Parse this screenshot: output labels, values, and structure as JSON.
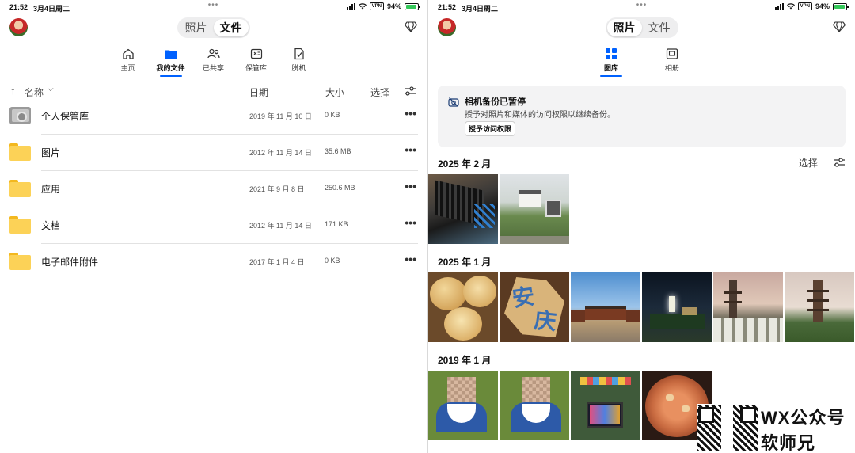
{
  "status": {
    "time": "21:52",
    "date": "3月4日周二",
    "battery": "94%",
    "vpn": "VPN",
    "dots": "•••"
  },
  "left": {
    "segment": {
      "photos": "照片",
      "files": "文件"
    },
    "nav": [
      {
        "label": "主页",
        "icon": "home-icon"
      },
      {
        "label": "我的文件",
        "icon": "folder-icon",
        "active": true
      },
      {
        "label": "已共享",
        "icon": "people-icon"
      },
      {
        "label": "保管库",
        "icon": "vault-icon"
      },
      {
        "label": "脱机",
        "icon": "offline-icon"
      }
    ],
    "table": {
      "name_col": "名称",
      "date_col": "日期",
      "size_col": "大小",
      "select": "选择",
      "rows": [
        {
          "name": "个人保管库",
          "date": "2019 年 11 月 10 日",
          "size": "0 KB",
          "icon": "vault-icon"
        },
        {
          "name": "图片",
          "date": "2012 年 11 月 14 日",
          "size": "35.6 MB",
          "icon": "folder-icon"
        },
        {
          "name": "应用",
          "date": "2021 年 9 月 8 日",
          "size": "250.6 MB",
          "icon": "folder-icon"
        },
        {
          "name": "文档",
          "date": "2012 年 11 月 14 日",
          "size": "171 KB",
          "icon": "folder-icon"
        },
        {
          "name": "电子邮件附件",
          "date": "2017 年 1 月 4 日",
          "size": "0 KB",
          "icon": "folder-icon"
        }
      ],
      "more": "•••"
    }
  },
  "right": {
    "segment": {
      "photos": "照片",
      "files": "文件"
    },
    "nav": [
      {
        "label": "图库",
        "icon": "gallery-icon",
        "active": true
      },
      {
        "label": "相册",
        "icon": "album-icon"
      }
    ],
    "banner": {
      "title": "相机备份已暂停",
      "desc": "授予对照片和媒体的访问权限以继续备份。",
      "button": "授予访问权限"
    },
    "select": "选择",
    "sections": [
      {
        "title": "2025 年 2 月",
        "count": 2
      },
      {
        "title": "2025 年 1 月",
        "count": 6
      },
      {
        "title": "2019 年 1 月",
        "count": 4
      }
    ]
  },
  "watermark": {
    "line1": "WX公众号",
    "line2": "软师兄"
  },
  "colors": {
    "accent": "#0061fe",
    "folder": "#fcd257",
    "banner_bg": "#f3f3f4"
  }
}
